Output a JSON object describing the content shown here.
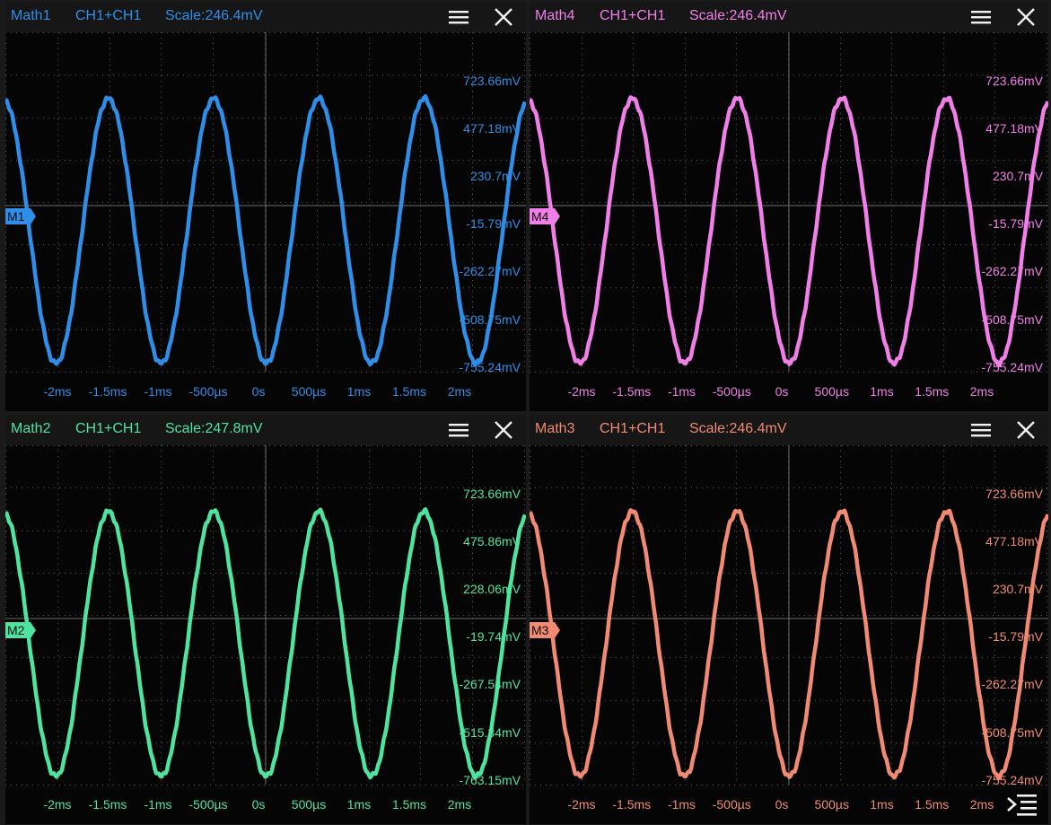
{
  "panels": [
    {
      "id": "math1",
      "color": "#2f8fe8",
      "name": "Math1",
      "source": "CH1+CH1",
      "scale": "Scale:246.4mV",
      "marker": "M1",
      "y_labels": [
        "723.66mV",
        "477.18mV",
        "230.7mV",
        "-15.79mV",
        "-262.27mV",
        "-508.75mV",
        "-755.24mV"
      ],
      "x_labels": [
        "-2ms",
        "-1.5ms",
        "-1ms",
        "-500µs",
        "0s",
        "500µs",
        "1ms",
        "1.5ms",
        "2ms"
      ],
      "menu_icon": "hamburger-icon",
      "close_icon": "close-icon"
    },
    {
      "id": "math4",
      "color": "#f07fe8",
      "name": "Math4",
      "source": "CH1+CH1",
      "scale": "Scale:246.4mV",
      "marker": "M4",
      "y_labels": [
        "723.66mV",
        "477.18mV",
        "230.7mV",
        "-15.79mV",
        "-262.27mV",
        "-508.75mV",
        "-755.24mV"
      ],
      "x_labels": [
        "-2ms",
        "-1.5ms",
        "-1ms",
        "-500µs",
        "0s",
        "500µs",
        "1ms",
        "1.5ms",
        "2ms"
      ],
      "menu_icon": "hamburger-icon",
      "close_icon": "close-icon"
    },
    {
      "id": "math2",
      "color": "#4fe3a0",
      "name": "Math2",
      "source": "CH1+CH1",
      "scale": "Scale:247.8mV",
      "marker": "M2",
      "y_labels": [
        "723.66mV",
        "475.86mV",
        "228.06mV",
        "-19.74mV",
        "-267.54mV",
        "-515.34mV",
        "-763.15mV"
      ],
      "x_labels": [
        "-2ms",
        "-1.5ms",
        "-1ms",
        "-500µs",
        "0s",
        "500µs",
        "1ms",
        "1.5ms",
        "2ms"
      ],
      "menu_icon": "hamburger-icon",
      "close_icon": "close-icon"
    },
    {
      "id": "math3",
      "color": "#f08a72",
      "name": "Math3",
      "source": "CH1+CH1",
      "scale": "Scale:246.4mV",
      "marker": "M3",
      "y_labels": [
        "723.66mV",
        "477.18mV",
        "230.7mV",
        "-15.79mV",
        "-262.27mV",
        "-508.75mV",
        "-755.24mV"
      ],
      "x_labels": [
        "-2ms",
        "-1.5ms",
        "-1ms",
        "-500µs",
        "0s",
        "500µs",
        "1ms",
        "1.5ms",
        "2ms"
      ],
      "menu_icon": "hamburger-icon",
      "close_icon": "close-icon"
    }
  ],
  "corner_menu_icon": "collapse-menu-icon"
}
